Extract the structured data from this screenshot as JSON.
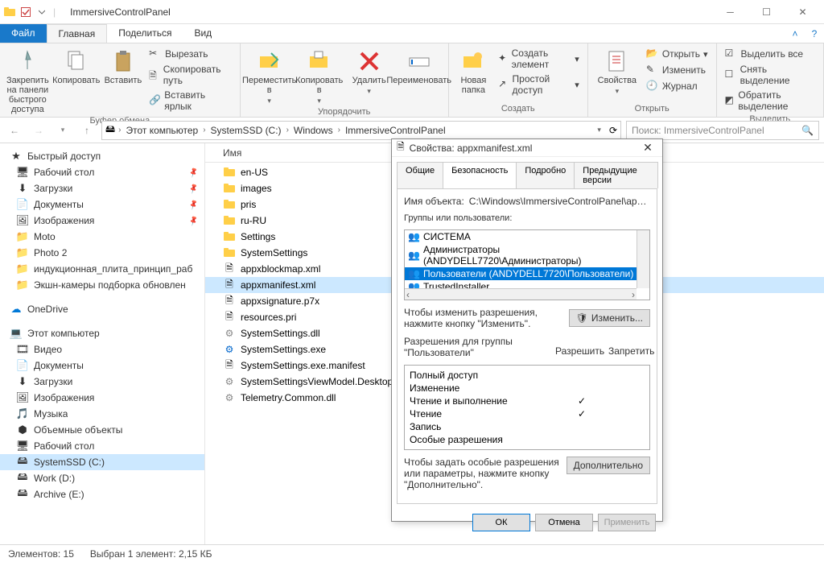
{
  "window": {
    "title": "ImmersiveControlPanel"
  },
  "tabs": {
    "file": "Файл",
    "home": "Главная",
    "share": "Поделиться",
    "view": "Вид"
  },
  "ribbon": {
    "clipboard": {
      "label": "Буфер обмена",
      "pin": "Закрепить на панели быстрого доступа",
      "copy": "Копировать",
      "paste": "Вставить",
      "cut": "Вырезать",
      "copypath": "Скопировать путь",
      "pasteshortcut": "Вставить ярлык"
    },
    "organize": {
      "label": "Упорядочить",
      "moveto": "Переместить в",
      "copyto": "Копировать в",
      "delete": "Удалить",
      "rename": "Переименовать"
    },
    "create": {
      "label": "Создать",
      "newfolder": "Новая папка",
      "newitem": "Создать элемент",
      "easyaccess": "Простой доступ"
    },
    "open": {
      "label": "Открыть",
      "properties": "Свойства",
      "open": "Открыть",
      "edit": "Изменить",
      "history": "Журнал"
    },
    "select": {
      "label": "Выделить",
      "selectall": "Выделить все",
      "selectnone": "Снять выделение",
      "invert": "Обратить выделение"
    }
  },
  "breadcrumbs": [
    "Этот компьютер",
    "SystemSSD (C:)",
    "Windows",
    "ImmersiveControlPanel"
  ],
  "search": {
    "placeholder": "Поиск: ImmersiveControlPanel"
  },
  "nav": {
    "quickaccess": "Быстрый доступ",
    "qa_items": [
      {
        "label": "Рабочий стол",
        "icon": "desktop"
      },
      {
        "label": "Загрузки",
        "icon": "downloads"
      },
      {
        "label": "Документы",
        "icon": "documents"
      },
      {
        "label": "Изображения",
        "icon": "pictures"
      },
      {
        "label": "Moto",
        "icon": "folder"
      },
      {
        "label": "Photo 2",
        "icon": "folder"
      },
      {
        "label": "индукционная_плита_принцип_раб",
        "icon": "folder"
      },
      {
        "label": "Экшн-камеры подборка обновлен",
        "icon": "folder"
      }
    ],
    "onedrive": "OneDrive",
    "thispc": "Этот компьютер",
    "pc_items": [
      {
        "label": "Видео",
        "icon": "video"
      },
      {
        "label": "Документы",
        "icon": "documents"
      },
      {
        "label": "Загрузки",
        "icon": "downloads"
      },
      {
        "label": "Изображения",
        "icon": "pictures"
      },
      {
        "label": "Музыка",
        "icon": "music"
      },
      {
        "label": "Объемные объекты",
        "icon": "3d"
      },
      {
        "label": "Рабочий стол",
        "icon": "desktop"
      },
      {
        "label": "SystemSSD (C:)",
        "icon": "drive",
        "selected": true
      },
      {
        "label": "Work (D:)",
        "icon": "drive"
      },
      {
        "label": "Archive (E:)",
        "icon": "drive"
      }
    ]
  },
  "files": {
    "header": "Имя",
    "items": [
      {
        "name": "en-US",
        "type": "folder"
      },
      {
        "name": "images",
        "type": "folder"
      },
      {
        "name": "pris",
        "type": "folder"
      },
      {
        "name": "ru-RU",
        "type": "folder"
      },
      {
        "name": "Settings",
        "type": "folder"
      },
      {
        "name": "SystemSettings",
        "type": "folder"
      },
      {
        "name": "appxblockmap.xml",
        "type": "xml"
      },
      {
        "name": "appxmanifest.xml",
        "type": "xml",
        "selected": true
      },
      {
        "name": "appxsignature.p7x",
        "type": "file"
      },
      {
        "name": "resources.pri",
        "type": "file"
      },
      {
        "name": "SystemSettings.dll",
        "type": "dll"
      },
      {
        "name": "SystemSettings.exe",
        "type": "exe"
      },
      {
        "name": "SystemSettings.exe.manifest",
        "type": "file"
      },
      {
        "name": "SystemSettingsViewModel.Desktop.dll",
        "type": "dll"
      },
      {
        "name": "Telemetry.Common.dll",
        "type": "dll"
      }
    ]
  },
  "status": {
    "count": "Элементов: 15",
    "selection": "Выбран 1 элемент: 2,15 КБ"
  },
  "dialog": {
    "title": "Свойства: appxmanifest.xml",
    "tabs": [
      "Общие",
      "Безопасность",
      "Подробно",
      "Предыдущие версии"
    ],
    "objectname_label": "Имя объекта:",
    "objectname_value": "C:\\Windows\\ImmersiveControlPanel\\appxmanifest.xm",
    "groups_label": "Группы или пользователи:",
    "groups": [
      "СИСТЕМА",
      "Администраторы (ANDYDELL7720\\Администраторы)",
      "Пользователи (ANDYDELL7720\\Пользователи)",
      "TrustedInstaller"
    ],
    "edit_hint": "Чтобы изменить разрешения, нажмите кнопку \"Изменить\".",
    "edit_btn": "Изменить...",
    "perm_label_prefix": "Разрешения для группы",
    "perm_label_group": "\"Пользователи\"",
    "perm_allow": "Разрешить",
    "perm_deny": "Запретить",
    "perms": [
      {
        "name": "Полный доступ",
        "allow": false
      },
      {
        "name": "Изменение",
        "allow": false
      },
      {
        "name": "Чтение и выполнение",
        "allow": true
      },
      {
        "name": "Чтение",
        "allow": true
      },
      {
        "name": "Запись",
        "allow": false
      },
      {
        "name": "Особые разрешения",
        "allow": false
      }
    ],
    "adv_hint": "Чтобы задать особые разрешения или параметры, нажмите кнопку \"Дополнительно\".",
    "adv_btn": "Дополнительно",
    "ok": "ОК",
    "cancel": "Отмена",
    "apply": "Применить"
  }
}
